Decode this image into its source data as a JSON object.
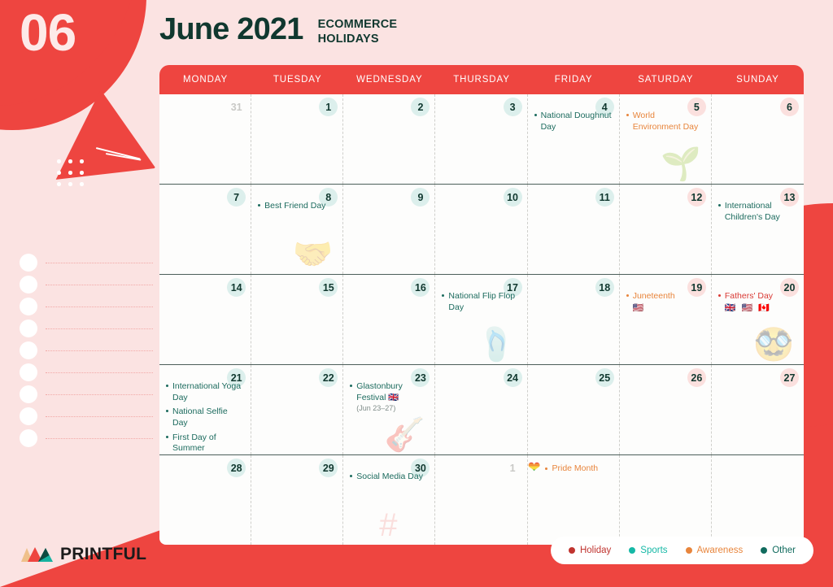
{
  "header": {
    "month_number": "06",
    "title": "June 2021",
    "subtitle": "ECOMMERCE\nHOLIDAYS"
  },
  "weekdays": [
    "MONDAY",
    "TUESDAY",
    "WEDNESDAY",
    "THURSDAY",
    "FRIDAY",
    "SATURDAY",
    "SUNDAY"
  ],
  "weeks": [
    [
      {
        "num": "31",
        "muted": true,
        "weekend": false,
        "events": []
      },
      {
        "num": "1",
        "muted": false,
        "weekend": false,
        "events": []
      },
      {
        "num": "2",
        "muted": false,
        "weekend": false,
        "events": []
      },
      {
        "num": "3",
        "muted": false,
        "weekend": false,
        "events": []
      },
      {
        "num": "4",
        "muted": false,
        "weekend": false,
        "events": [
          {
            "label": "National Doughnut Day",
            "category": "other"
          }
        ]
      },
      {
        "num": "5",
        "muted": false,
        "weekend": true,
        "watermark": "🌱",
        "events": [
          {
            "label": "World Environment Day",
            "category": "awareness"
          }
        ]
      },
      {
        "num": "6",
        "muted": false,
        "weekend": true,
        "events": []
      }
    ],
    [
      {
        "num": "7",
        "muted": false,
        "weekend": false,
        "events": []
      },
      {
        "num": "8",
        "muted": false,
        "weekend": false,
        "watermark": "🤝",
        "events": [
          {
            "label": "Best Friend Day",
            "category": "other"
          }
        ]
      },
      {
        "num": "9",
        "muted": false,
        "weekend": false,
        "events": []
      },
      {
        "num": "10",
        "muted": false,
        "weekend": false,
        "events": []
      },
      {
        "num": "11",
        "muted": false,
        "weekend": false,
        "events": []
      },
      {
        "num": "12",
        "muted": false,
        "weekend": true,
        "events": []
      },
      {
        "num": "13",
        "muted": false,
        "weekend": true,
        "events": [
          {
            "label": "International Children's Day",
            "category": "other"
          }
        ]
      }
    ],
    [
      {
        "num": "14",
        "muted": false,
        "weekend": false,
        "events": []
      },
      {
        "num": "15",
        "muted": false,
        "weekend": false,
        "events": []
      },
      {
        "num": "16",
        "muted": false,
        "weekend": false,
        "events": []
      },
      {
        "num": "17",
        "muted": false,
        "weekend": false,
        "watermark": "🩴",
        "events": [
          {
            "label": "National Flip Flop Day",
            "category": "other"
          }
        ]
      },
      {
        "num": "18",
        "muted": false,
        "weekend": false,
        "events": []
      },
      {
        "num": "19",
        "muted": false,
        "weekend": true,
        "events": [
          {
            "label": "Juneteenth",
            "category": "awareness",
            "flags": "🇺🇸"
          }
        ]
      },
      {
        "num": "20",
        "muted": false,
        "weekend": true,
        "watermark": "🥸",
        "events": [
          {
            "label": "Fathers' Day",
            "category": "holiday",
            "flags": "🇬🇧 🇺🇸 🇨🇦"
          }
        ]
      }
    ],
    [
      {
        "num": "21",
        "muted": false,
        "weekend": false,
        "events": [
          {
            "label": "International Yoga Day",
            "category": "other"
          },
          {
            "label": "National Selfie Day",
            "category": "other"
          },
          {
            "label": "First Day of Summer",
            "category": "other"
          }
        ]
      },
      {
        "num": "22",
        "muted": false,
        "weekend": false,
        "events": []
      },
      {
        "num": "23",
        "muted": false,
        "weekend": false,
        "watermark": "🎸",
        "events": [
          {
            "label": "Glastonbury Festival",
            "category": "other",
            "inline_flag": "🇬🇧",
            "note": "(Jun 23–27)"
          }
        ]
      },
      {
        "num": "24",
        "muted": false,
        "weekend": false,
        "events": []
      },
      {
        "num": "25",
        "muted": false,
        "weekend": false,
        "events": []
      },
      {
        "num": "26",
        "muted": false,
        "weekend": true,
        "events": []
      },
      {
        "num": "27",
        "muted": false,
        "weekend": true,
        "events": []
      }
    ],
    [
      {
        "num": "28",
        "muted": false,
        "weekend": false,
        "events": []
      },
      {
        "num": "29",
        "muted": false,
        "weekend": false,
        "events": []
      },
      {
        "num": "30",
        "muted": false,
        "weekend": false,
        "watermark": "#",
        "events": [
          {
            "label": "Social Media Day",
            "category": "other"
          }
        ]
      },
      {
        "num": "1",
        "muted": true,
        "weekend": false,
        "events": []
      },
      {
        "num": "",
        "muted": true,
        "weekend": false,
        "events": []
      },
      {
        "num": "",
        "muted": true,
        "weekend": true,
        "events": []
      },
      {
        "num": "",
        "muted": true,
        "weekend": true,
        "events": []
      }
    ]
  ],
  "month_banner": {
    "icon": "🏳️‍🌈",
    "heart": "❤",
    "label": "Pride Month",
    "category": "awareness"
  },
  "brand": {
    "name": "PRINTFUL"
  },
  "legend": {
    "items": [
      {
        "label": "Holiday",
        "color": "#C0342F"
      },
      {
        "label": "Sports",
        "color": "#15B8A6"
      },
      {
        "label": "Awareness",
        "color": "#E8853C"
      },
      {
        "label": "Other",
        "color": "#116B5E"
      }
    ]
  },
  "colors": {
    "red": "#EE4540",
    "pink_bg": "#FBE3E2",
    "dark_green": "#10382F",
    "weekday_pill": "#DCEFEC",
    "weekend_pill": "#FBE0DE"
  }
}
